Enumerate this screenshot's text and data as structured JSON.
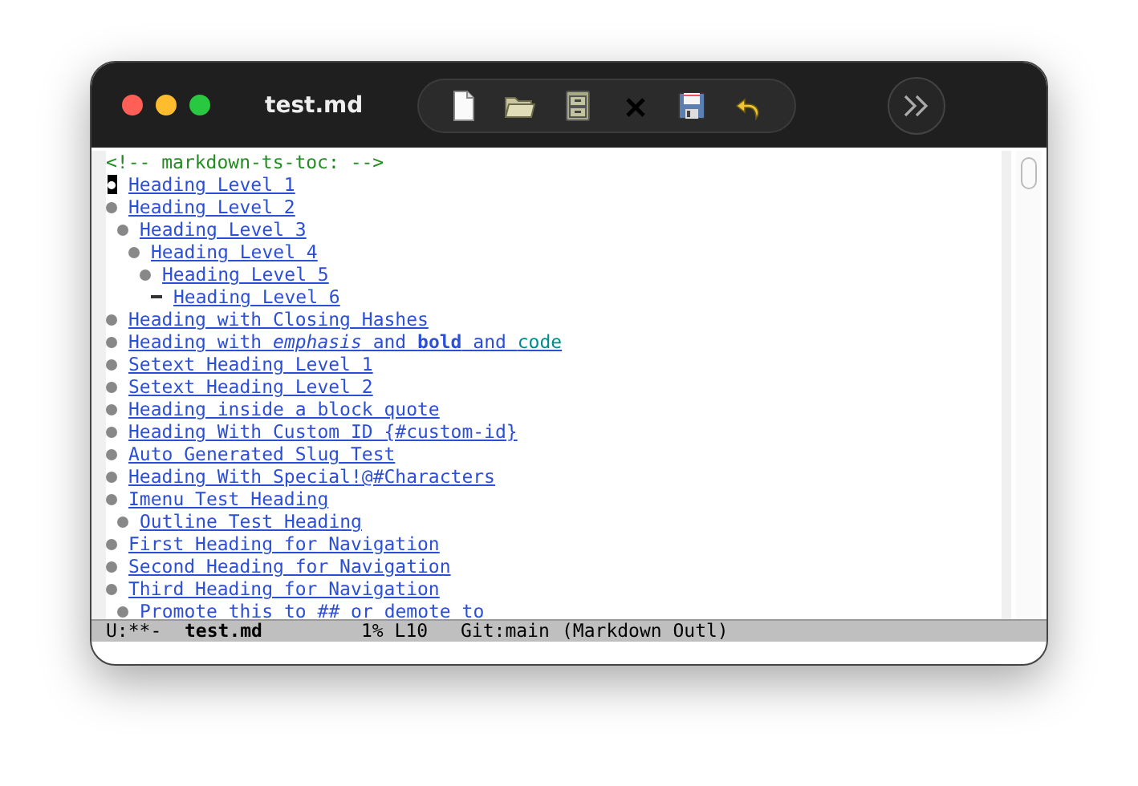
{
  "window": {
    "title": "test.md"
  },
  "toolbar": {
    "buttons": [
      {
        "kind": "new"
      },
      {
        "kind": "open"
      },
      {
        "kind": "cabinet"
      },
      {
        "kind": "close"
      },
      {
        "kind": "save"
      },
      {
        "kind": "undo"
      }
    ]
  },
  "editor": {
    "comment": "<!-- markdown-ts-toc: -->",
    "toc": [
      {
        "kind": "bullet",
        "cursor": true,
        "text": "Heading Level 1"
      },
      {
        "kind": "bullet",
        "cursor": false,
        "text": "Heading Level 2",
        "children": [
          {
            "kind": "bullet",
            "cursor": false,
            "text": "Heading Level 3",
            "children": [
              {
                "kind": "bullet",
                "cursor": false,
                "text": "Heading Level 4",
                "children": [
                  {
                    "kind": "bullet",
                    "cursor": false,
                    "text": "Heading Level 5",
                    "children": [
                      {
                        "kind": "dash",
                        "cursor": false,
                        "text": "Heading Level 6"
                      }
                    ]
                  }
                ]
              }
            ]
          }
        ]
      },
      {
        "kind": "bullet",
        "cursor": false,
        "text": "Heading with Closing Hashes"
      },
      {
        "kind": "bullet",
        "cursor": false,
        "parts": [
          {
            "kind": "plain",
            "text": "Heading with "
          },
          {
            "kind": "italic",
            "text": "emphasis"
          },
          {
            "kind": "plain",
            "text": " and "
          },
          {
            "kind": "bold",
            "text": "bold"
          },
          {
            "kind": "plain",
            "text": " and "
          },
          {
            "kind": "code",
            "text": "code"
          }
        ]
      },
      {
        "kind": "bullet",
        "cursor": false,
        "text": "Setext Heading Level 1"
      },
      {
        "kind": "bullet",
        "cursor": false,
        "text": "Setext Heading Level 2"
      },
      {
        "kind": "bullet",
        "cursor": false,
        "text": "Heading inside a block quote"
      },
      {
        "kind": "bullet",
        "cursor": false,
        "text": "Heading With Custom ID {#custom-id}"
      },
      {
        "kind": "bullet",
        "cursor": false,
        "text": "Auto Generated Slug Test"
      },
      {
        "kind": "bullet",
        "cursor": false,
        "text": "Heading With Special!@#Characters"
      },
      {
        "kind": "bullet",
        "cursor": false,
        "text": "Imenu Test Heading",
        "children": [
          {
            "kind": "bullet",
            "cursor": false,
            "text": "Outline Test Heading"
          }
        ]
      },
      {
        "kind": "bullet",
        "cursor": false,
        "text": "First Heading for Navigation"
      },
      {
        "kind": "bullet",
        "cursor": false,
        "text": "Second Heading for Navigation"
      },
      {
        "kind": "bullet",
        "cursor": false,
        "text": "Third Heading for Navigation",
        "children": [
          {
            "kind": "bullet",
            "cursor": false,
            "text": "Promote this to ## or demote to"
          }
        ]
      }
    ]
  },
  "status_bar": {
    "state": "U:**-",
    "buffer": "test.md",
    "position": "1% L10",
    "vc": "Git:main",
    "mode": "(Markdown Outl)"
  }
}
